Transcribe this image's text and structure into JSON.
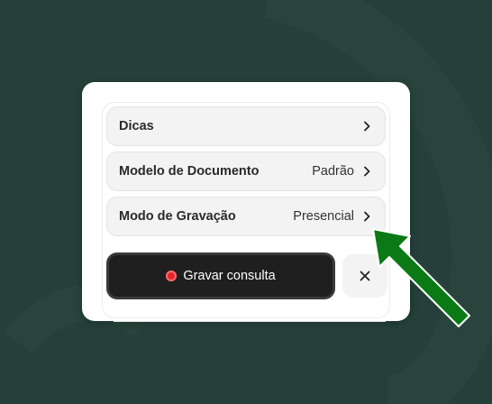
{
  "menu": {
    "items": [
      {
        "label": "Dicas",
        "value": ""
      },
      {
        "label": "Modelo de Documento",
        "value": "Padrão"
      },
      {
        "label": "Modo de Gravação",
        "value": "Presencial"
      }
    ]
  },
  "record_button": {
    "label": "Gravar consulta"
  },
  "colors": {
    "background": "#25403a",
    "record_dot": "#e5262e",
    "annotation_arrow": "#0b7a16"
  }
}
